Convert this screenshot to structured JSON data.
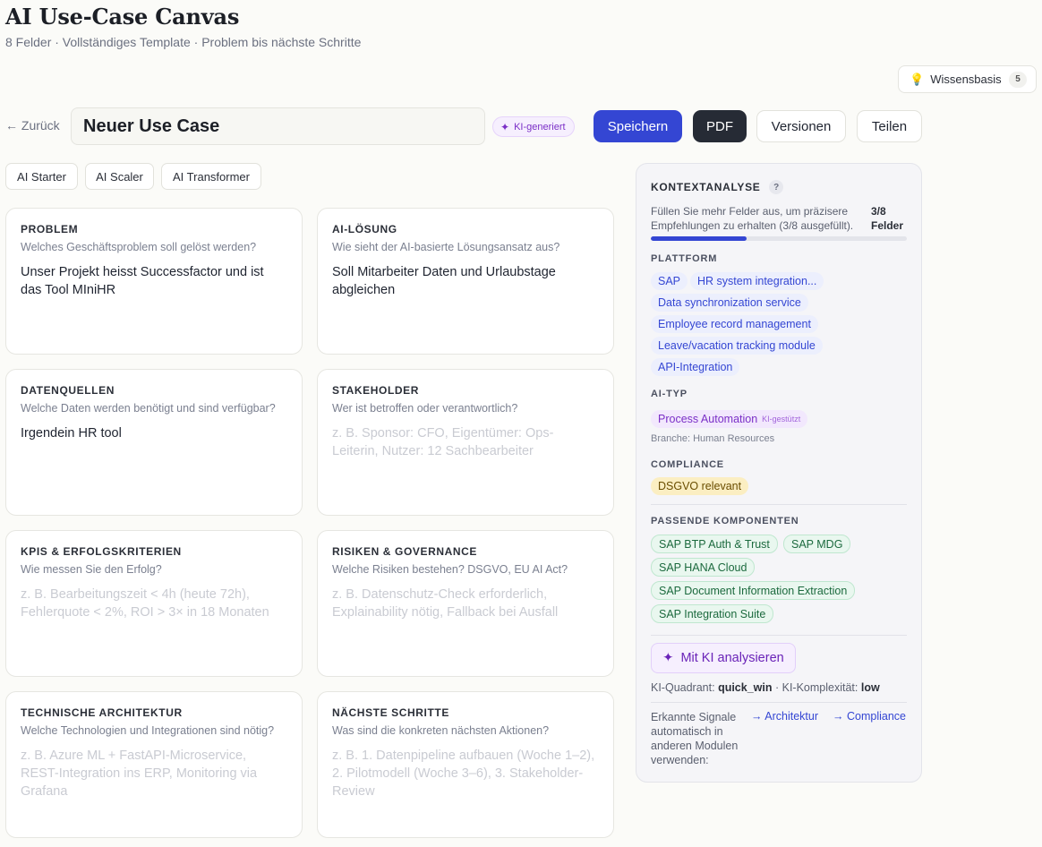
{
  "page": {
    "title": "AI Use-Case Canvas",
    "subtitle": "8 Felder · Vollständiges Template · Problem bis nächste Schritte"
  },
  "knowledge_base": {
    "label": "Wissensbasis",
    "count": "5",
    "icon": "lightbulb-icon"
  },
  "toolbar": {
    "back_label": "← Zurück",
    "title_value": "Neuer Use Case",
    "ai_badge": "KI-generiert",
    "save_label": "Speichern",
    "pdf_label": "PDF",
    "versions_label": "Versionen",
    "share_label": "Teilen"
  },
  "templates": [
    "AI Starter",
    "AI Scaler",
    "AI Transformer"
  ],
  "fields": [
    {
      "label": "PROBLEM",
      "hint": "Welches Geschäftsproblem soll gelöst werden?",
      "value": "Unser Projekt heisst Successfactor und ist das Tool MIniHR",
      "placeholder": ""
    },
    {
      "label": "AI-LÖSUNG",
      "hint": "Wie sieht der AI-basierte Lösungsansatz aus?",
      "value": "Soll Mitarbeiter Daten und Urlaubstage abgleichen",
      "placeholder": ""
    },
    {
      "label": "DATENQUELLEN",
      "hint": "Welche Daten werden benötigt und sind verfügbar?",
      "value": "Irgendein HR tool",
      "placeholder": ""
    },
    {
      "label": "STAKEHOLDER",
      "hint": "Wer ist betroffen oder verantwortlich?",
      "value": "",
      "placeholder": "z. B. Sponsor: CFO, Eigentümer: Ops-Leiterin, Nutzer: 12 Sachbearbeiter"
    },
    {
      "label": "KPIS & ERFOLGSKRITERIEN",
      "hint": "Wie messen Sie den Erfolg?",
      "value": "",
      "placeholder": "z. B. Bearbeitungszeit < 4h (heute 72h), Fehlerquote < 2%, ROI > 3× in 18 Monaten"
    },
    {
      "label": "RISIKEN & GOVERNANCE",
      "hint": "Welche Risiken bestehen? DSGVO, EU AI Act?",
      "value": "",
      "placeholder": "z. B. Datenschutz-Check erforderlich, Explainability nötig, Fallback bei Ausfall"
    },
    {
      "label": "TECHNISCHE ARCHITEKTUR",
      "hint": "Welche Technologien und Integrationen sind nötig?",
      "value": "",
      "placeholder": "z. B. Azure ML + FastAPI-Microservice, REST-Integration ins ERP, Monitoring via Grafana"
    },
    {
      "label": "NÄCHSTE SCHRITTE",
      "hint": "Was sind die konkreten nächsten Aktionen?",
      "value": "",
      "placeholder": "z. B. 1. Datenpipeline aufbauen (Woche 1–2), 2. Pilotmodell (Woche 3–6), 3. Stakeholder-Review"
    }
  ],
  "context": {
    "title": "KONTEXTANALYSE",
    "help": "?",
    "description": "Füllen Sie mehr Felder aus, um präzisere Empfehlungen zu erhalten (3/8 ausgefüllt).",
    "count": "3/8 Felder",
    "progress": 0.375,
    "platform_label": "PLATTFORM",
    "platform_chips": [
      "SAP",
      "HR system integration...",
      "Data synchronization service",
      "Employee record management",
      "Leave/vacation tracking module",
      "API-Integration"
    ],
    "ai_type_label": "AI-TYP",
    "ai_type": "Process Automation",
    "ai_type_badge": "KI-gestützt",
    "industry": "Branche: Human Resources",
    "compliance_label": "COMPLIANCE",
    "compliance_chip": "DSGVO relevant",
    "components_label": "PASSENDE KOMPONENTEN",
    "components": [
      "SAP BTP Auth & Trust",
      "SAP MDG",
      "SAP HANA Cloud",
      "SAP Document Information Extraction",
      "SAP Integration Suite"
    ],
    "analyze_label": "Mit KI analysieren",
    "quadrant_prefix": "KI-Quadrant:",
    "quadrant_value": "quick_win",
    "complexity_prefix": "· KI-Komplexität:",
    "complexity_value": "low",
    "signals_label": "Erkannte Signale automatisch in anderen Modulen verwenden:",
    "signal_links": [
      "→ Architektur",
      "→ Compliance"
    ]
  },
  "colors": {
    "accent": "#3446d3",
    "dark": "#262b35",
    "ai_purple": "#7b2fc7",
    "green": "#1c6a3e"
  }
}
